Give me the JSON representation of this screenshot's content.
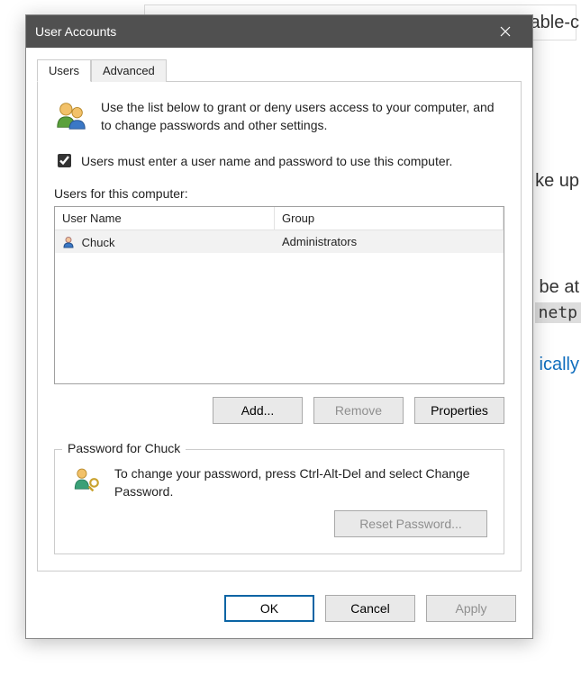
{
  "window": {
    "title": "User Accounts"
  },
  "tabs": {
    "users": "Users",
    "advanced": "Advanced"
  },
  "intro_text": "Use the list below to grant or deny users access to your computer, and to change passwords and other settings.",
  "checkbox": {
    "label": "Users must enter a user name and password to use this computer.",
    "checked": true
  },
  "users_section": {
    "label": "Users for this computer:",
    "columns": {
      "user": "User Name",
      "group": "Group"
    },
    "rows": [
      {
        "user": "Chuck",
        "group": "Administrators"
      }
    ]
  },
  "buttons": {
    "add": "Add...",
    "remove": "Remove",
    "properties": "Properties",
    "reset_password": "Reset Password...",
    "ok": "OK",
    "cancel": "Cancel",
    "apply": "Apply"
  },
  "password_section": {
    "legend": "Password for Chuck",
    "text": "To change your password, press Ctrl-Alt-Del and select Change Password."
  },
  "background": {
    "partial1": "able-c",
    "partial2": "ke up",
    "partial3": "be at",
    "code": "netp",
    "link": "ically"
  }
}
